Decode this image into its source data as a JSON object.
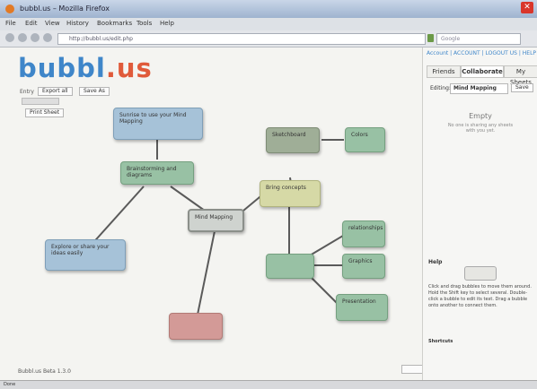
{
  "browser": {
    "title": "bubbl.us – Mozilla Firefox",
    "menu": [
      "File",
      "Edit",
      "View",
      "History",
      "Bookmarks",
      "Tools",
      "Help"
    ],
    "url": "http://bubbl.us/edit.php",
    "search_placeholder": "Google"
  },
  "app": {
    "logo_part1": "bubbl",
    "logo_part2": ".us",
    "toolbar": {
      "label": "Entry",
      "btn1": "Export all",
      "btn2": "Save As",
      "btn3": "Print Sheet"
    },
    "status_text": "Bubbl.us Beta 1.3.0"
  },
  "mindmap": {
    "nodes": [
      {
        "id": "n1",
        "label": "Sunrise to use your Mind Mapping",
        "style": "n-blue"
      },
      {
        "id": "n2",
        "label": "Brainstorming and diagrams",
        "style": "n-green"
      },
      {
        "id": "n3",
        "label": "Mind Mapping",
        "style": "n-grey"
      },
      {
        "id": "n4",
        "label": "Explore or share your ideas easily",
        "style": "n-blue"
      },
      {
        "id": "n5",
        "label": "",
        "style": "n-pink"
      },
      {
        "id": "n6",
        "label": "Bring concepts",
        "style": "n-yellow"
      },
      {
        "id": "n7",
        "label": "Sketchboard",
        "style": "n-sage"
      },
      {
        "id": "n8",
        "label": "Colors",
        "style": "n-green"
      },
      {
        "id": "n9",
        "label": "",
        "style": "n-green"
      },
      {
        "id": "n10",
        "label": "relationships",
        "style": "n-green"
      },
      {
        "id": "n11",
        "label": "Graphics",
        "style": "n-green"
      },
      {
        "id": "n12",
        "label": "Presentation",
        "style": "n-green"
      }
    ]
  },
  "sidebar": {
    "user_links": "Account | ACCOUNT | LOGOUT US | HELP",
    "tabs": [
      "Friends",
      "Collaborate",
      "My Sheets"
    ],
    "editing_label": "Editing:",
    "editing_value": "Mind Mapping",
    "save_label": "Save",
    "empty_title": "Empty",
    "empty_text": "No one is sharing any sheets with you yet.",
    "help_title": "Help",
    "help_text": "Click and drag bubbles to move them around. Hold the Shift key to select several. Double-click a bubble to edit its text. Drag a bubble onto another to connect them.",
    "help_footer": "Shortcuts"
  },
  "status": {
    "left": "Done"
  },
  "colors": {
    "logo_blue": "#3f86c9",
    "logo_orange": "#e05a3a",
    "close_red": "#d9362b"
  }
}
